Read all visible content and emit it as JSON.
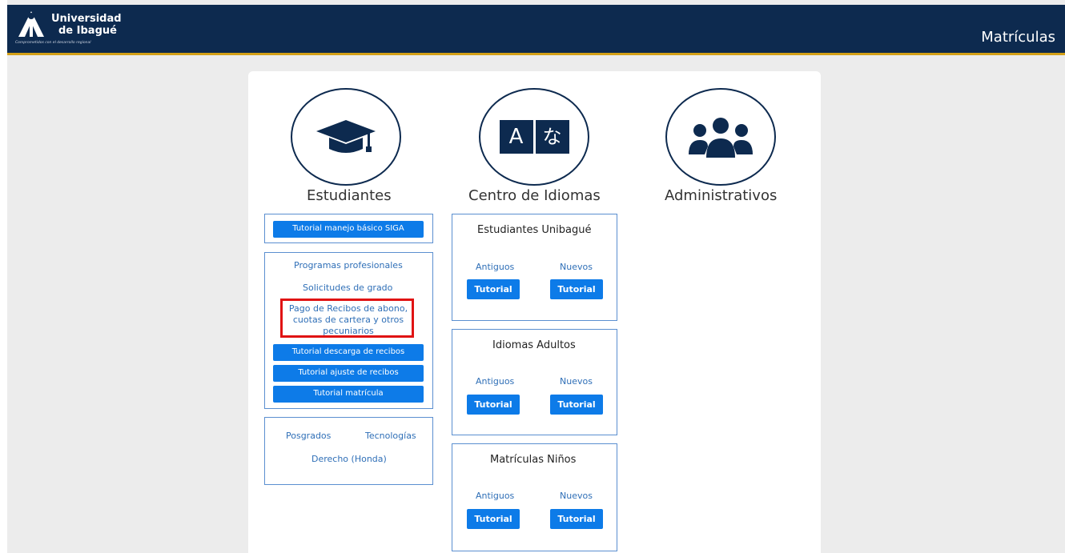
{
  "header": {
    "logo_line1": "Universidad",
    "logo_line2": "de Ibagué",
    "logo_tagline": "Comprometidos con el desarrollo regional",
    "title": "Matrículas",
    "colors": {
      "bar": "#0d2a4f",
      "accent": "#d4a017"
    }
  },
  "categories": {
    "students": {
      "title": "Estudiantes",
      "icon": "graduation-cap-icon"
    },
    "languages": {
      "title": "Centro de Idiomas",
      "icon": "language-icon",
      "glyph_a": "A",
      "glyph_b": "な"
    },
    "admin": {
      "title": "Administrativos",
      "icon": "users-icon"
    }
  },
  "students": {
    "siga_button": "Tutorial manejo básico SIGA",
    "programs": {
      "link_professional": "Programas profesionales",
      "link_degree": "Solicitudes de grado",
      "link_payment": "Pago de Recibos de abono, cuotas de cartera y otros pecuniarios",
      "btn_download": "Tutorial descarga de recibos",
      "btn_adjust": "Tutorial ajuste de recibos",
      "btn_enroll": "Tutorial matrícula"
    },
    "other": {
      "link_postgrad": "Posgrados",
      "link_tech": "Tecnologías",
      "link_law": "Derecho (Honda)"
    }
  },
  "languages": {
    "boxes": [
      {
        "title": "Estudiantes Unibagué",
        "old": "Antiguos",
        "new": "Nuevos",
        "btn_old": "Tutorial",
        "btn_new": "Tutorial"
      },
      {
        "title": "Idiomas Adultos",
        "old": "Antiguos",
        "new": "Nuevos",
        "btn_old": "Tutorial",
        "btn_new": "Tutorial"
      },
      {
        "title": "Matrículas Niños",
        "old": "Antiguos",
        "new": "Nuevos",
        "btn_old": "Tutorial",
        "btn_new": "Tutorial"
      }
    ]
  },
  "colors": {
    "button": "#0d7be8",
    "link": "#2f6fb7",
    "highlight": "#e01313"
  }
}
